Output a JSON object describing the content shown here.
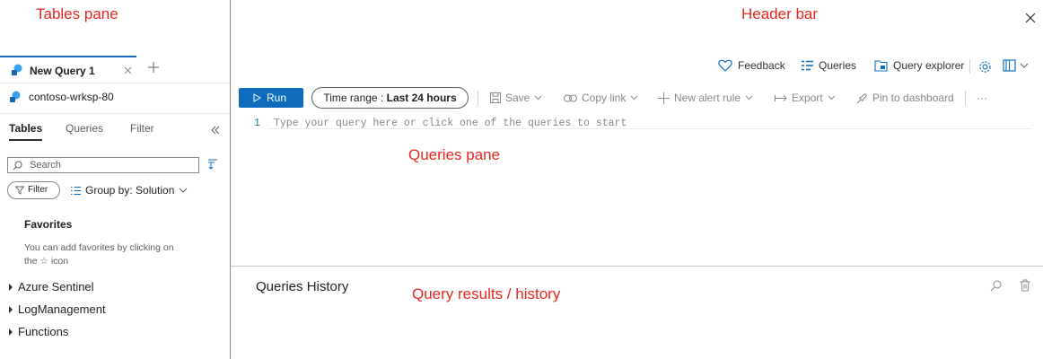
{
  "annotations": {
    "tables_pane": "Tables pane",
    "header_bar": "Header bar",
    "queries_pane": "Queries pane",
    "results": "Query results / history"
  },
  "query_tab": {
    "title": "New Query 1"
  },
  "workspace": {
    "name": "contoso-wrksp-80"
  },
  "left_tabs": [
    "Tables",
    "Queries",
    "Filter"
  ],
  "search": {
    "placeholder": "Search"
  },
  "filter_label": "Filter",
  "group_by_label": "Group by: Solution",
  "favorites": {
    "title": "Favorites",
    "hint_line1": "You can add favorites by clicking on",
    "hint_line2": "the ☆ icon"
  },
  "tree_items": [
    "Azure Sentinel",
    "LogManagement",
    "Functions"
  ],
  "header": {
    "feedback": "Feedback",
    "queries": "Queries",
    "query_explorer": "Query explorer"
  },
  "toolbar": {
    "run": "Run",
    "time_range_prefix": "Time range :",
    "time_range_value": "Last 24 hours",
    "save": "Save",
    "copy_link": "Copy link",
    "new_alert_rule": "New alert rule",
    "export": "Export",
    "pin_to_dashboard": "Pin to dashboard",
    "more": "···"
  },
  "editor": {
    "line_number": "1",
    "placeholder": "Type your query here or click one of the queries to start"
  },
  "history": {
    "title": "Queries History"
  },
  "colors": {
    "accent": "#0f6cbd",
    "annotation": "#e8261f"
  },
  "icons": [
    "close-icon",
    "heart-icon",
    "queries-icon",
    "query-explorer-icon",
    "gear-icon",
    "book-icon",
    "chevron-down-icon",
    "play-icon",
    "save-icon",
    "link-icon",
    "plus-icon",
    "export-icon",
    "pin-icon",
    "search-icon",
    "delete-icon",
    "filter-icon",
    "list-icon",
    "collapse-icon",
    "workspace-icon"
  ]
}
